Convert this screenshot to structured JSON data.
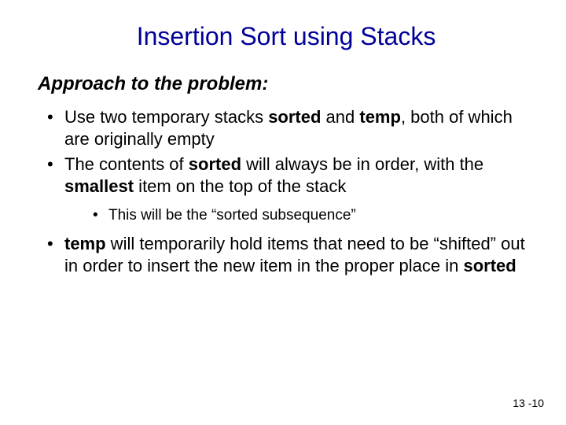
{
  "title": "Insertion Sort using Stacks",
  "subtitle": "Approach to the problem:",
  "bullets": {
    "b1_pre": "Use two temporary stacks ",
    "b1_s1": "sorted",
    "b1_mid": " and ",
    "b1_s2": "temp",
    "b1_post": ", both of which are originally empty",
    "b2_pre": "The contents of ",
    "b2_s1": "sorted",
    "b2_mid": " will always be in order, with the ",
    "b2_s2": "smallest",
    "b2_post": " item on the top of the stack",
    "b2_sub": "This will be the “sorted subsequence”",
    "b3_s1": "temp",
    "b3_mid": " will temporarily hold items that need to be “shifted” out in order to insert the new item in the proper place in ",
    "b3_s2": "sorted"
  },
  "pagenum": "13 -10"
}
